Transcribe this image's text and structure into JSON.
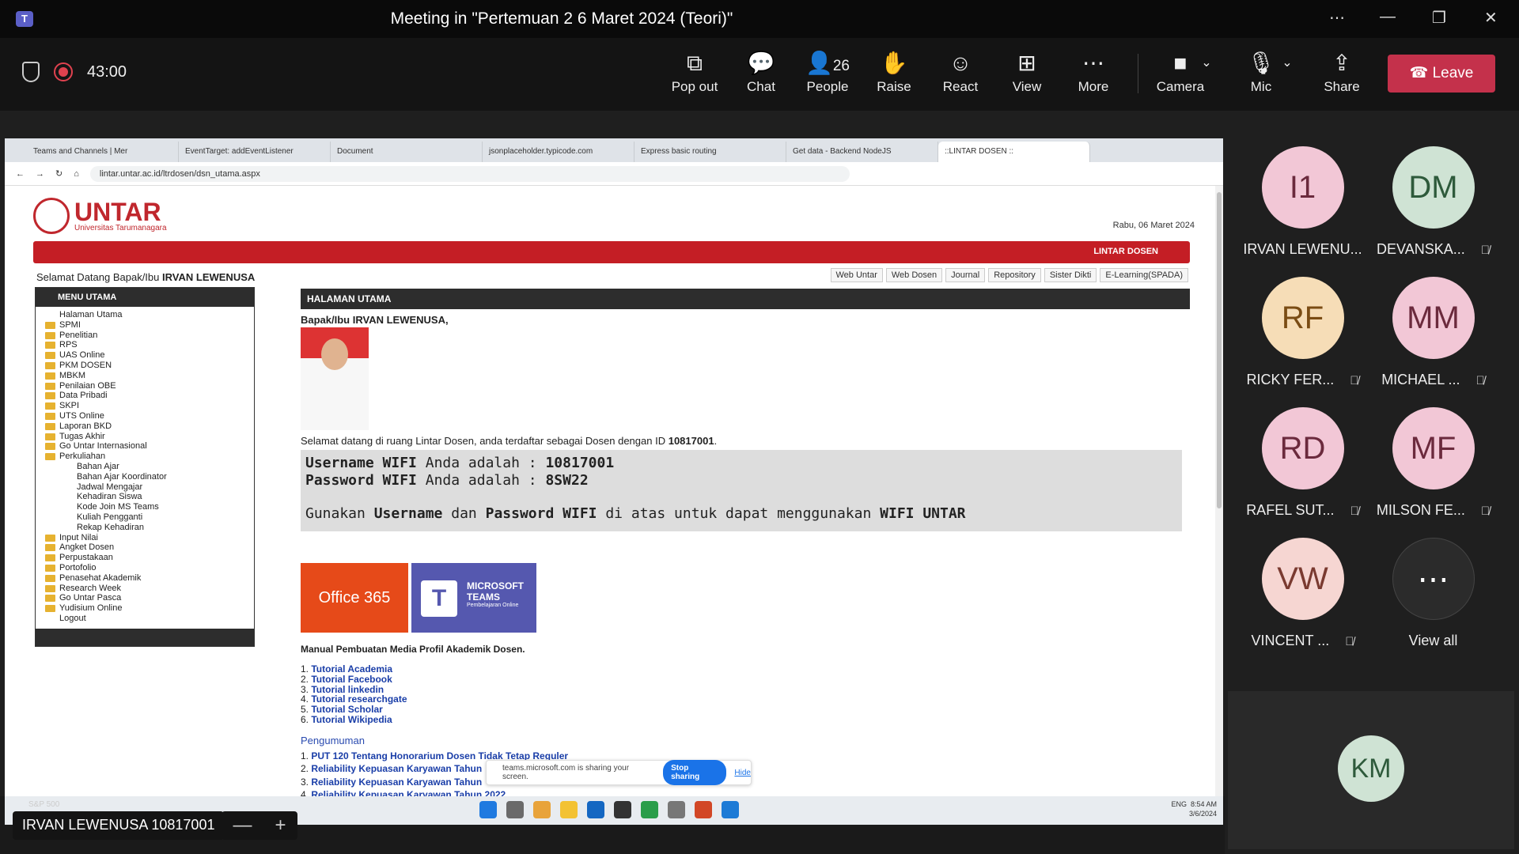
{
  "window": {
    "title": "Meeting in \"Pertemuan 2 6 Maret 2024 (Teori)\"",
    "controls": [
      "⋯",
      "—",
      "❐",
      "✕"
    ]
  },
  "toolbar": {
    "timer": "43:00",
    "buttons": [
      {
        "label": "Pop out",
        "icon": "⧉"
      },
      {
        "label": "Chat",
        "icon": "💬"
      },
      {
        "label": "People",
        "icon": "👤",
        "count": "26"
      },
      {
        "label": "Raise",
        "icon": "✋"
      },
      {
        "label": "React",
        "icon": "☺"
      },
      {
        "label": "View",
        "icon": "⊞"
      },
      {
        "label": "More",
        "icon": "⋯"
      }
    ],
    "camera_label": "Camera",
    "mic_label": "Mic",
    "share_label": "Share",
    "leave_label": "Leave"
  },
  "browser": {
    "tabs": [
      "Teams and Channels | Mer",
      "EventTarget: addEventListener",
      "Document",
      "jsonplaceholder.typicode.com",
      "Express basic routing",
      "Get data - Backend NodeJS",
      "::LINTAR DOSEN ::"
    ],
    "url": "lintar.untar.ac.id/ltrdosen/dsn_utama.aspx"
  },
  "site": {
    "brand": "UNTAR",
    "brand_sub": "Universitas Tarumanagara",
    "date": "Rabu, 06 Maret 2024",
    "banner": "LINTAR DOSEN",
    "welcome_prefix": "Selamat Datang Bapak/Ibu",
    "welcome_name": "IRVAN LEWENUSA",
    "quick_links": [
      "Web Untar",
      "Web Dosen",
      "Journal",
      "Repository",
      "Sister Dikti",
      "E-Learning(SPADA)"
    ],
    "menu_title": "MENU UTAMA",
    "menu": [
      {
        "label": "Halaman Utama",
        "folder": false,
        "sub": false
      },
      {
        "label": "SPMI",
        "folder": true,
        "sub": false
      },
      {
        "label": "Penelitian",
        "folder": true,
        "sub": false
      },
      {
        "label": "RPS",
        "folder": true,
        "sub": false
      },
      {
        "label": "UAS Online",
        "folder": true,
        "sub": false
      },
      {
        "label": "PKM DOSEN",
        "folder": true,
        "sub": false
      },
      {
        "label": "MBKM",
        "folder": true,
        "sub": false
      },
      {
        "label": "Penilaian OBE",
        "folder": true,
        "sub": false
      },
      {
        "label": "Data Pribadi",
        "folder": true,
        "sub": false
      },
      {
        "label": "SKPI",
        "folder": true,
        "sub": false
      },
      {
        "label": "UTS Online",
        "folder": true,
        "sub": false
      },
      {
        "label": "Laporan BKD",
        "folder": true,
        "sub": false
      },
      {
        "label": "Tugas Akhir",
        "folder": true,
        "sub": false
      },
      {
        "label": "Go Untar Internasional",
        "folder": true,
        "sub": false
      },
      {
        "label": "Perkuliahan",
        "folder": true,
        "sub": false
      },
      {
        "label": "Bahan Ajar",
        "folder": false,
        "sub": true
      },
      {
        "label": "Bahan Ajar Koordinator",
        "folder": false,
        "sub": true
      },
      {
        "label": "Jadwal Mengajar",
        "folder": false,
        "sub": true
      },
      {
        "label": "Kehadiran Siswa",
        "folder": false,
        "sub": true
      },
      {
        "label": "Kode Join MS Teams",
        "folder": false,
        "sub": true
      },
      {
        "label": "Kuliah Pengganti",
        "folder": false,
        "sub": true
      },
      {
        "label": "Rekap Kehadiran",
        "folder": false,
        "sub": true
      },
      {
        "label": "Input Nilai",
        "folder": true,
        "sub": false
      },
      {
        "label": "Angket Dosen",
        "folder": true,
        "sub": false
      },
      {
        "label": "Perpustakaan",
        "folder": true,
        "sub": false
      },
      {
        "label": "Portofolio",
        "folder": true,
        "sub": false
      },
      {
        "label": "Penasehat Akademik",
        "folder": true,
        "sub": false
      },
      {
        "label": "Research Week",
        "folder": true,
        "sub": false
      },
      {
        "label": "Go Untar Pasca",
        "folder": true,
        "sub": false
      },
      {
        "label": "Yudisium Online",
        "folder": true,
        "sub": false
      },
      {
        "label": "Logout",
        "folder": false,
        "sub": false
      }
    ],
    "main_title": "HALAMAN UTAMA",
    "greeting": "Bapak/Ibu IRVAN LEWENUSA,",
    "info_prefix": "Selamat datang di ruang Lintar Dosen, anda terdaftar sebagai Dosen dengan ID",
    "info_id": "10817001",
    "wifi_user_label": "Username WIFI",
    "wifi_user_mid": "Anda adalah :",
    "wifi_user_value": "10817001",
    "wifi_pass_label": "Password WIFI",
    "wifi_pass_mid": "Anda adalah :",
    "wifi_pass_value": "8SW22",
    "wifi_note_1": "Gunakan",
    "wifi_note_2": "Username",
    "wifi_note_3": "dan",
    "wifi_note_4": "Password WIFI",
    "wifi_note_5": "di atas untuk dapat menggunakan",
    "wifi_note_6": "WIFI UNTAR",
    "office_label": "Office 365",
    "teams_label_1": "MICROSOFT",
    "teams_label_2": "TEAMS",
    "teams_label_3": "Pembelajaran Online",
    "manual_title": "Manual Pembuatan Media Profil Akademik Dosen.",
    "tutorials": [
      "Tutorial Academia",
      "Tutorial Facebook",
      "Tutorial linkedin",
      "Tutorial researchgate",
      "Tutorial Scholar",
      "Tutorial Wikipedia"
    ],
    "announce_title": "Pengumuman",
    "announcements": [
      "PUT 120 Tentang Honorarium Dosen Tidak Tetap Reguler",
      "Reliability Kepuasan Karyawan Tahun",
      "Reliability Kepuasan Karyawan Tahun",
      "Reliability Kepuasan Karyawan Tahun 2022"
    ]
  },
  "sharebar": {
    "text": "teams.microsoft.com is sharing your screen.",
    "stop": "Stop sharing",
    "hide": "Hide"
  },
  "taskbar": {
    "ticker": "S&P 500",
    "lang": "ENG",
    "time": "8:54 AM",
    "date": "3/6/2024"
  },
  "stage": {
    "name_tag": "IRVAN LEWENUSA 10817001",
    "zoom_out": "—",
    "zoom_in": "+"
  },
  "participants": [
    {
      "initials": "I1",
      "name": "IRVAN LEWENU...",
      "muted": false,
      "bg": "#f2c7d6",
      "fg": "#6b2a3d"
    },
    {
      "initials": "DM",
      "name": "DEVANSKA...",
      "muted": true,
      "bg": "#cfe3d4",
      "fg": "#2e5a3b"
    },
    {
      "initials": "RF",
      "name": "RICKY FER...",
      "muted": true,
      "bg": "#f6ddb7",
      "fg": "#7a4c14"
    },
    {
      "initials": "MM",
      "name": "MICHAEL ...",
      "muted": true,
      "bg": "#f2c7d6",
      "fg": "#6b2a3d"
    },
    {
      "initials": "RD",
      "name": "RAFEL SUT...",
      "muted": true,
      "bg": "#f2c7d6",
      "fg": "#6b2a3d"
    },
    {
      "initials": "MF",
      "name": "MILSON FE...",
      "muted": true,
      "bg": "#f2c7d6",
      "fg": "#6b2a3d"
    },
    {
      "initials": "VW",
      "name": "VINCENT ...",
      "muted": true,
      "bg": "#f6d6d2",
      "fg": "#7a3a30"
    },
    {
      "initials": "⋯",
      "name": "View all",
      "muted": false,
      "bg": "#2b2b2b",
      "fg": "#ffffff"
    }
  ],
  "spotlight": {
    "initials": "KM",
    "bg": "#cfe3d4",
    "fg": "#2e5a3b"
  }
}
